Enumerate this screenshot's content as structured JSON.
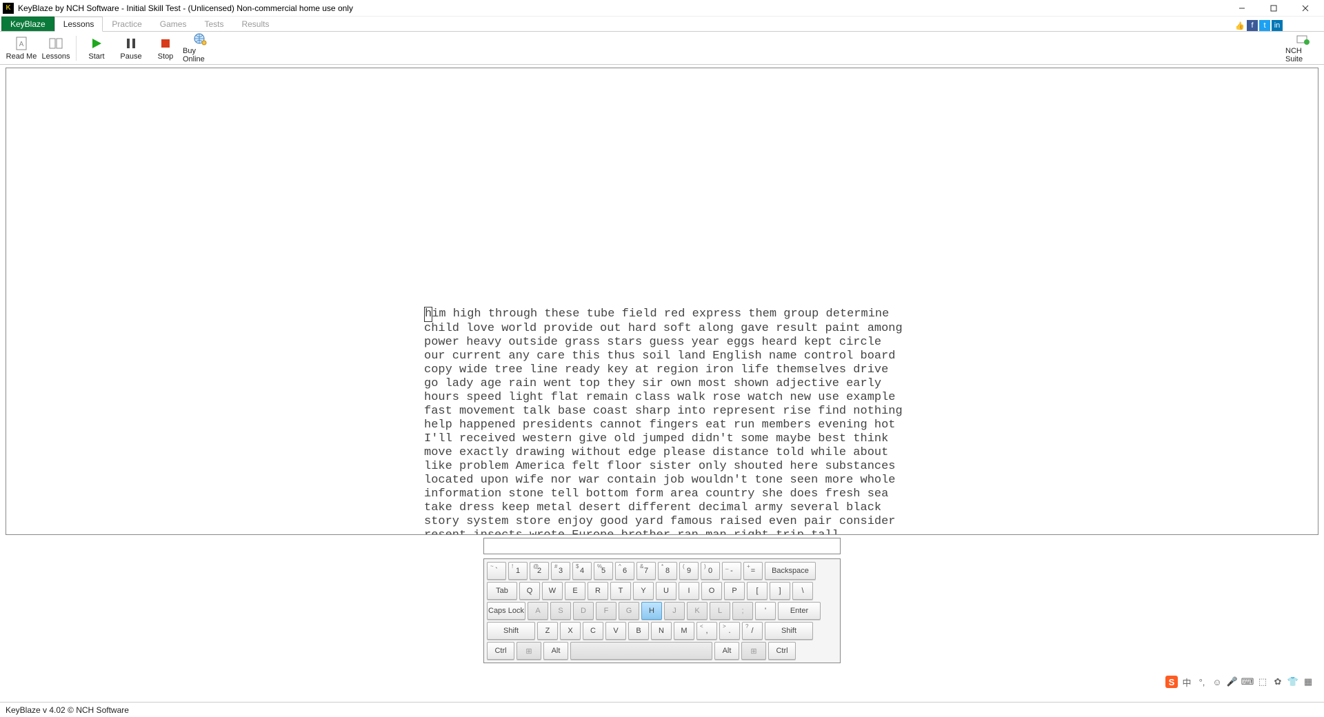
{
  "window": {
    "title": "KeyBlaze by NCH Software - Initial Skill Test - (Unlicensed) Non-commercial home use only"
  },
  "tabs": {
    "app": "KeyBlaze",
    "lessons": "Lessons",
    "practice": "Practice",
    "games": "Games",
    "tests": "Tests",
    "results": "Results"
  },
  "toolbar": {
    "readme": "Read Me",
    "lessons": "Lessons",
    "start": "Start",
    "pause": "Pause",
    "stop": "Stop",
    "buy": "Buy Online",
    "nchsuite": "NCH Suite"
  },
  "lesson_text": {
    "first_char": "h",
    "rest": "im high through these tube field red express them group determine child love world provide out hard soft along gave result paint among power heavy outside grass stars guess year eggs heard kept circle our current any care this thus soil land English name control board copy wide tree line ready key at region iron life themselves drive go lady age rain went top they sir own most shown adjective early hours speed light flat remain class walk rose watch new use example fast movement talk base coast sharp into represent rise find nothing help happened presidents cannot fingers eat run members evening hot I'll received western give old jumped didn't some maybe best think move exactly drawing without edge please distance told while about like problem America felt floor sister only shouted here substances located upon wife nor war contain job wouldn't tone seen more whole information stone tell bottom form area country she does fresh sea take dress keep metal desert different decimal army several black story system store enjoy good yard famous raised even pair consider resent insects wrote Europe brother ran man right trip tall molecules during almost true"
  },
  "typed_value": "",
  "keyboard": {
    "row1": [
      "`",
      "1",
      "2",
      "3",
      "4",
      "5",
      "6",
      "7",
      "8",
      "9",
      "0",
      "-",
      "="
    ],
    "row1_top": [
      "~",
      "!",
      "@",
      "#",
      "$",
      "%",
      "^",
      "&",
      "*",
      "(",
      ")",
      "_",
      "+"
    ],
    "backspace": "Backspace",
    "tab": "Tab",
    "row2": [
      "Q",
      "W",
      "E",
      "R",
      "T",
      "Y",
      "U",
      "I",
      "O",
      "P",
      "[",
      "]",
      "\\"
    ],
    "caps": "Caps Lock",
    "row3": [
      "A",
      "S",
      "D",
      "F",
      "G",
      "H",
      "J",
      "K",
      "L",
      ";",
      "'"
    ],
    "enter": "Enter",
    "shiftl": "Shift",
    "row4": [
      "Z",
      "X",
      "C",
      "V",
      "B",
      "N",
      "M",
      ",",
      ".",
      "/"
    ],
    "row4_top": [
      "",
      "",
      "",
      "",
      "",
      "",
      "",
      "<",
      ">",
      "?"
    ],
    "shiftr": "Shift",
    "ctrl": "Ctrl",
    "alt": "Alt",
    "highlighted": "H"
  },
  "ime": {
    "cn": "中"
  },
  "status": {
    "text": "KeyBlaze v 4.02 © NCH Software"
  }
}
